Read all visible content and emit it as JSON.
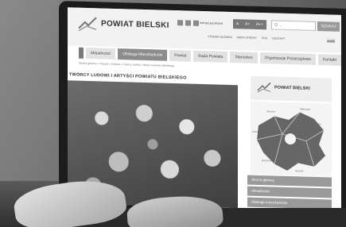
{
  "site": {
    "title": "POWIAT BIELSKI",
    "lang_label": "wersja językowa",
    "accessibility_labels": [
      "A",
      "A+",
      "A++"
    ],
    "search_placeholder": "Q ...",
    "search_button": "SZUKAJ",
    "top_links": [
      "STRONA GŁÓWNA",
      "MAPA STRONY",
      "RSS",
      "KONTAKT"
    ]
  },
  "nav": {
    "items": [
      {
        "label": "Aktualności",
        "active": false
      },
      {
        "label": "Obsługa Mieszkańców",
        "active": true
      },
      {
        "label": "Powiat",
        "active": false
      },
      {
        "label": "Rada Powiatu",
        "active": false
      },
      {
        "label": "Starostwo",
        "active": false
      },
      {
        "label": "Organizacje Pozarządowe",
        "active": false
      },
      {
        "label": "Kontakt",
        "active": false
      }
    ]
  },
  "breadcrumb": "Strona główna > Powiat > Kultura > Twórcy ludowi i artyści powiatu bielskiego",
  "article": {
    "title": "TWÓRCY LUDOWI I ARTYŚCI POWIATU BIELSKIEGO"
  },
  "sidebar": {
    "logo_text": "POWIAT BIELSKI",
    "map_labels": [
      "Jaworze",
      "Wilkowice",
      "Kozy",
      "Czechowice-Dziedzice",
      "Jasienica",
      "Buczkowice",
      "Szczyrk"
    ],
    "menu_items": [
      "Strona główna",
      "Aktualności",
      "Obsługa mieszkańców"
    ]
  },
  "colors": {
    "screen_bg": "#ffffff",
    "nav_active": "#8c8c8c",
    "sidebar_menu": "#9a9a9a"
  }
}
